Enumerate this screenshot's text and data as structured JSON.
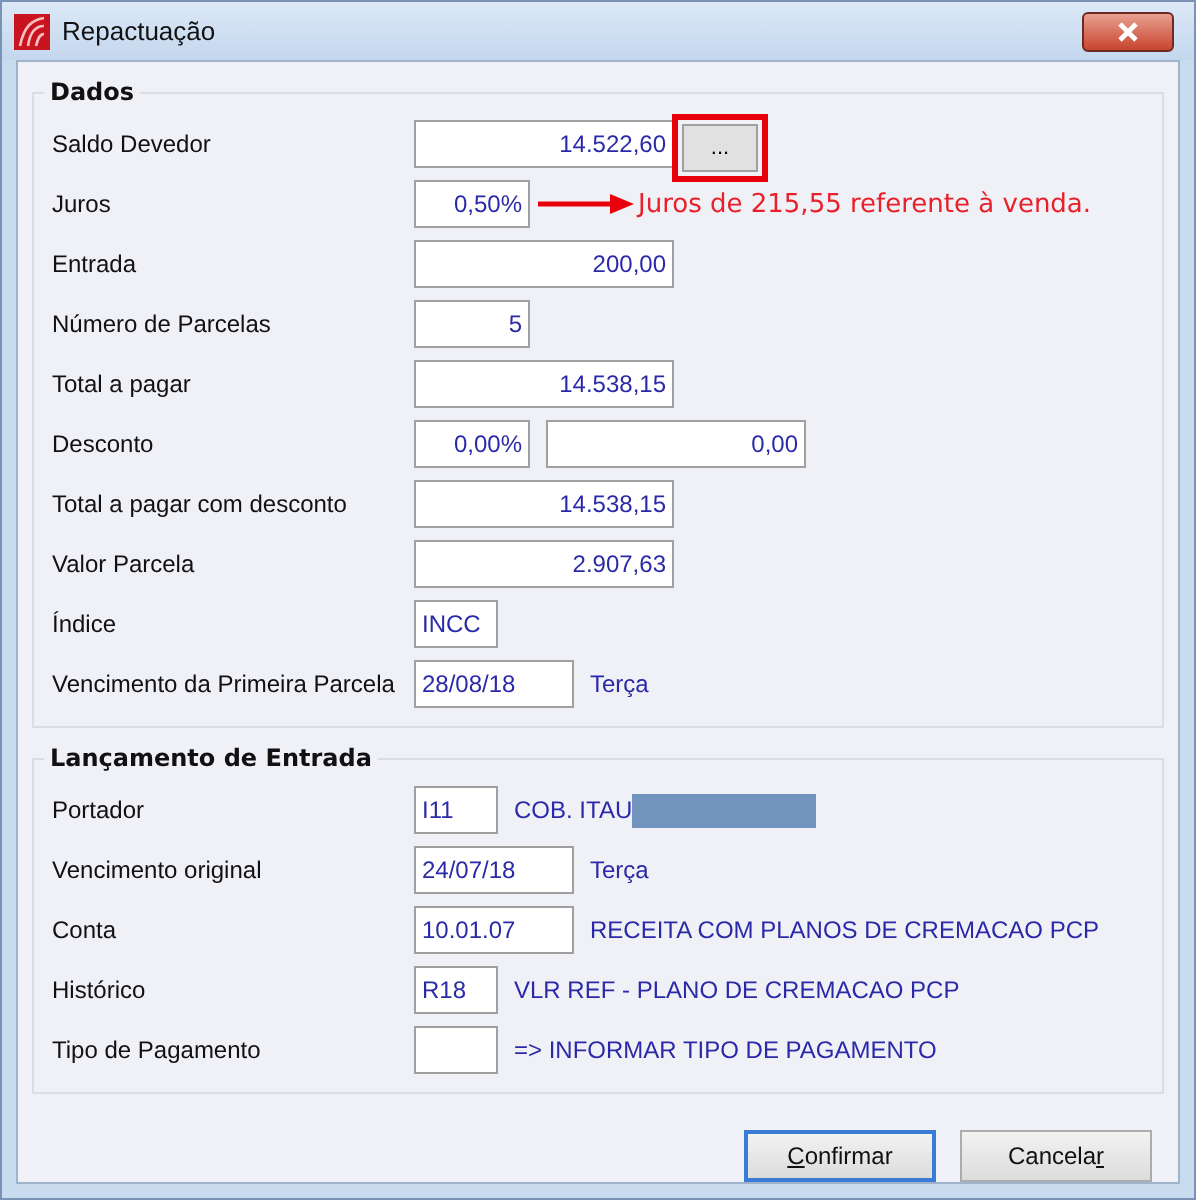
{
  "window": {
    "title": "Repactuação"
  },
  "groups": [
    {
      "title": "Dados",
      "rows": [
        {
          "label": "Saldo Devedor",
          "fields": [
            {
              "value": "14.522,60",
              "kind": "amount"
            }
          ],
          "button": {
            "label": "...",
            "highlighted": true
          }
        },
        {
          "label": "Juros",
          "fields": [
            {
              "value": "0,50%",
              "kind": "small"
            }
          ],
          "annotation": "Juros de 215,55 referente à venda."
        },
        {
          "label": "Entrada",
          "fields": [
            {
              "value": "200,00",
              "kind": "amount"
            }
          ]
        },
        {
          "label": "Número de Parcelas",
          "fields": [
            {
              "value": "5",
              "kind": "small"
            }
          ]
        },
        {
          "label": "Total a pagar",
          "fields": [
            {
              "value": "14.538,15",
              "kind": "amount"
            }
          ]
        },
        {
          "label": "Desconto",
          "fields": [
            {
              "value": "0,00%",
              "kind": "small"
            },
            {
              "value": "0,00",
              "kind": "amount"
            }
          ]
        },
        {
          "label": "Total a pagar com desconto",
          "fields": [
            {
              "value": "14.538,15",
              "kind": "amount"
            }
          ]
        },
        {
          "label": "Valor Parcela",
          "fields": [
            {
              "value": "2.907,63",
              "kind": "amount"
            }
          ]
        },
        {
          "label": "Índice",
          "fields": [
            {
              "value": "INCC",
              "kind": "code"
            }
          ]
        },
        {
          "label": "Vencimento da Primeira Parcela",
          "fields": [
            {
              "value": "28/08/18",
              "kind": "date"
            }
          ],
          "note": "Terça"
        }
      ]
    },
    {
      "title": "Lançamento de Entrada",
      "rows": [
        {
          "label": "Portador",
          "fields": [
            {
              "value": "I11",
              "kind": "code"
            }
          ],
          "note": "COB. ITAU",
          "redacted": true
        },
        {
          "label": "Vencimento original",
          "fields": [
            {
              "value": "24/07/18",
              "kind": "date"
            }
          ],
          "note": "Terça"
        },
        {
          "label": "Conta",
          "fields": [
            {
              "value": "10.01.07",
              "kind": "date"
            }
          ],
          "note": "RECEITA COM PLANOS DE CREMACAO PCP"
        },
        {
          "label": "Histórico",
          "fields": [
            {
              "value": "R18",
              "kind": "code"
            }
          ],
          "note": "VLR REF - PLANO DE CREMACAO PCP"
        },
        {
          "label": "Tipo de Pagamento",
          "fields": [
            {
              "kind": "code"
            }
          ],
          "note": "=> INFORMAR TIPO DE PAGAMENTO"
        }
      ]
    }
  ],
  "buttons": [
    {
      "key": "C",
      "after": "onfirmar",
      "default": true
    },
    {
      "before": "Cancela",
      "key": "r",
      "default": false
    }
  ]
}
